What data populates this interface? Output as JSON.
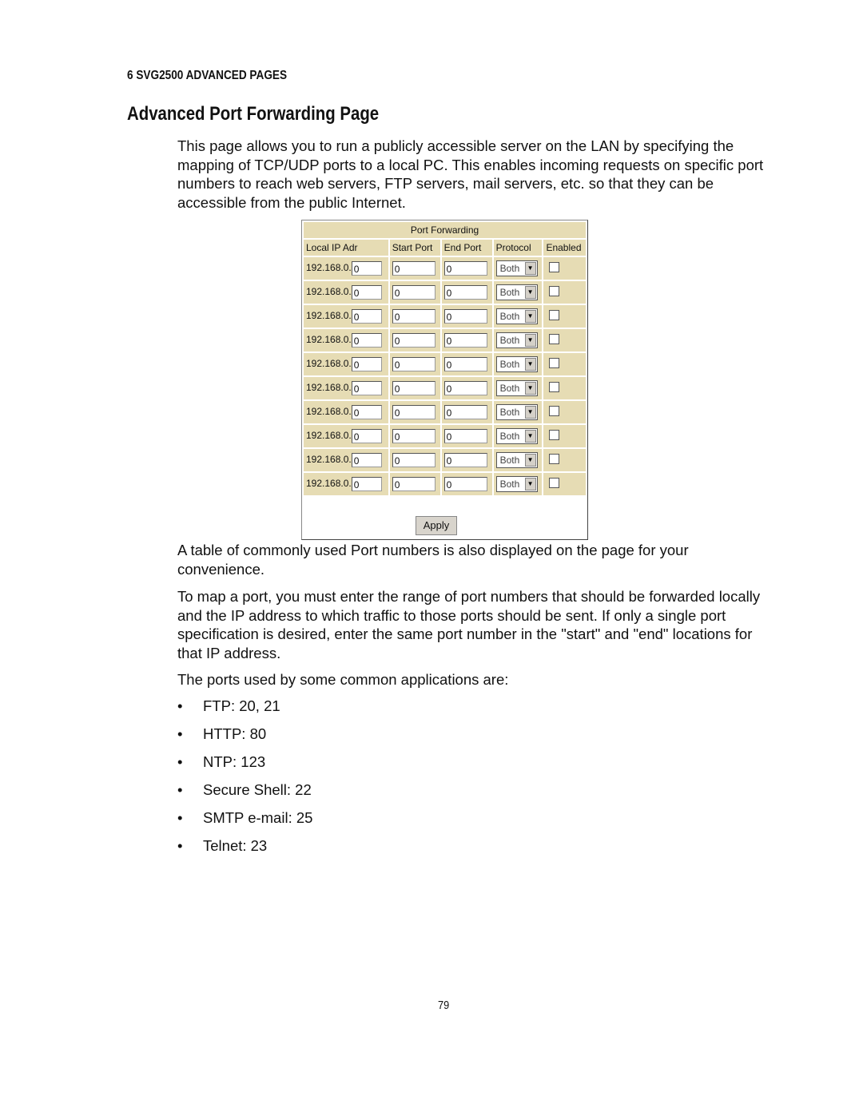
{
  "chapter": "6 SVG2500 ADVANCED PAGES",
  "title": "Advanced Port Forwarding Page",
  "intro": "This page allows you to run a publicly accessible server on the LAN by specifying the mapping of TCP/UDP ports to a local PC. This enables incoming requests on specific port numbers to reach web servers, FTP servers, mail servers, etc. so that they can be accessible from the public Internet.",
  "form": {
    "heading": "Port Forwarding",
    "columns": [
      "Local IP Adr",
      "Start Port",
      "End Port",
      "Protocol",
      "Enabled"
    ],
    "ip_prefix": "192.168.0.",
    "rows": [
      {
        "ip": "0",
        "start": "0",
        "end": "0",
        "protocol": "Both",
        "enabled": false
      },
      {
        "ip": "0",
        "start": "0",
        "end": "0",
        "protocol": "Both",
        "enabled": false
      },
      {
        "ip": "0",
        "start": "0",
        "end": "0",
        "protocol": "Both",
        "enabled": false
      },
      {
        "ip": "0",
        "start": "0",
        "end": "0",
        "protocol": "Both",
        "enabled": false
      },
      {
        "ip": "0",
        "start": "0",
        "end": "0",
        "protocol": "Both",
        "enabled": false
      },
      {
        "ip": "0",
        "start": "0",
        "end": "0",
        "protocol": "Both",
        "enabled": false
      },
      {
        "ip": "0",
        "start": "0",
        "end": "0",
        "protocol": "Both",
        "enabled": false
      },
      {
        "ip": "0",
        "start": "0",
        "end": "0",
        "protocol": "Both",
        "enabled": false
      },
      {
        "ip": "0",
        "start": "0",
        "end": "0",
        "protocol": "Both",
        "enabled": false
      },
      {
        "ip": "0",
        "start": "0",
        "end": "0",
        "protocol": "Both",
        "enabled": false
      }
    ],
    "apply_label": "Apply",
    "panel_color": "#e6dcb4"
  },
  "para2": "A table of commonly used Port numbers is also displayed on the page for your convenience.",
  "para3": "To map a port, you must enter the range of port numbers that should be forwarded locally and the IP address to which traffic to those ports should be sent. If only a single port specification is desired, enter the same port number in the \"start\" and \"end\" locations for that IP address.",
  "para4": "The ports used by some common applications are:",
  "bullets": [
    "FTP: 20, 21",
    "HTTP: 80",
    "NTP: 123",
    "Secure Shell: 22",
    "SMTP e-mail: 25",
    "Telnet: 23"
  ],
  "page_number": "79"
}
